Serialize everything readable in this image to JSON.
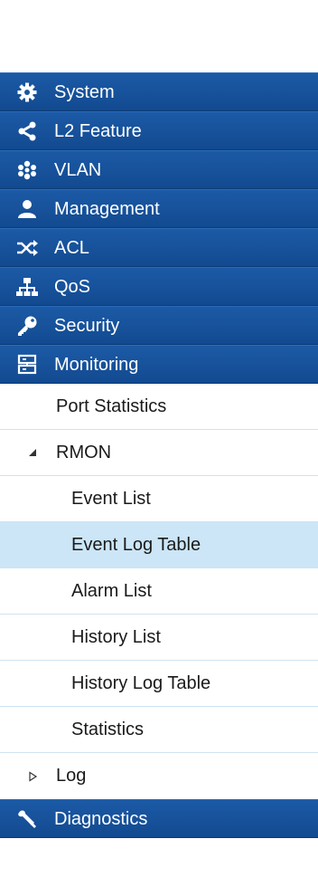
{
  "menu": {
    "top_items": [
      {
        "label": "System",
        "icon": "gear-icon"
      },
      {
        "label": "L2 Feature",
        "icon": "share-icon"
      },
      {
        "label": "VLAN",
        "icon": "vlan-icon"
      },
      {
        "label": "Management",
        "icon": "user-icon"
      },
      {
        "label": "ACL",
        "icon": "shuffle-icon"
      },
      {
        "label": "QoS",
        "icon": "network-icon"
      },
      {
        "label": "Security",
        "icon": "key-icon"
      },
      {
        "label": "Monitoring",
        "icon": "monitor-icon"
      }
    ],
    "monitoring_submenu": {
      "port_statistics": "Port Statistics",
      "rmon": {
        "label": "RMON",
        "toggle": "▲",
        "children": [
          "Event List",
          "Event Log Table",
          "Alarm List",
          "History List",
          "History Log Table",
          "Statistics"
        ],
        "selected": "Event Log Table"
      },
      "log": {
        "label": "Log",
        "toggle": "▷"
      }
    },
    "bottom_items": [
      {
        "label": "Diagnostics",
        "icon": "wrench-icon"
      }
    ]
  },
  "colors": {
    "nav_bg": "#1a55a0",
    "selected_bg": "#cce6f7",
    "divider": "#cfe3f3"
  }
}
